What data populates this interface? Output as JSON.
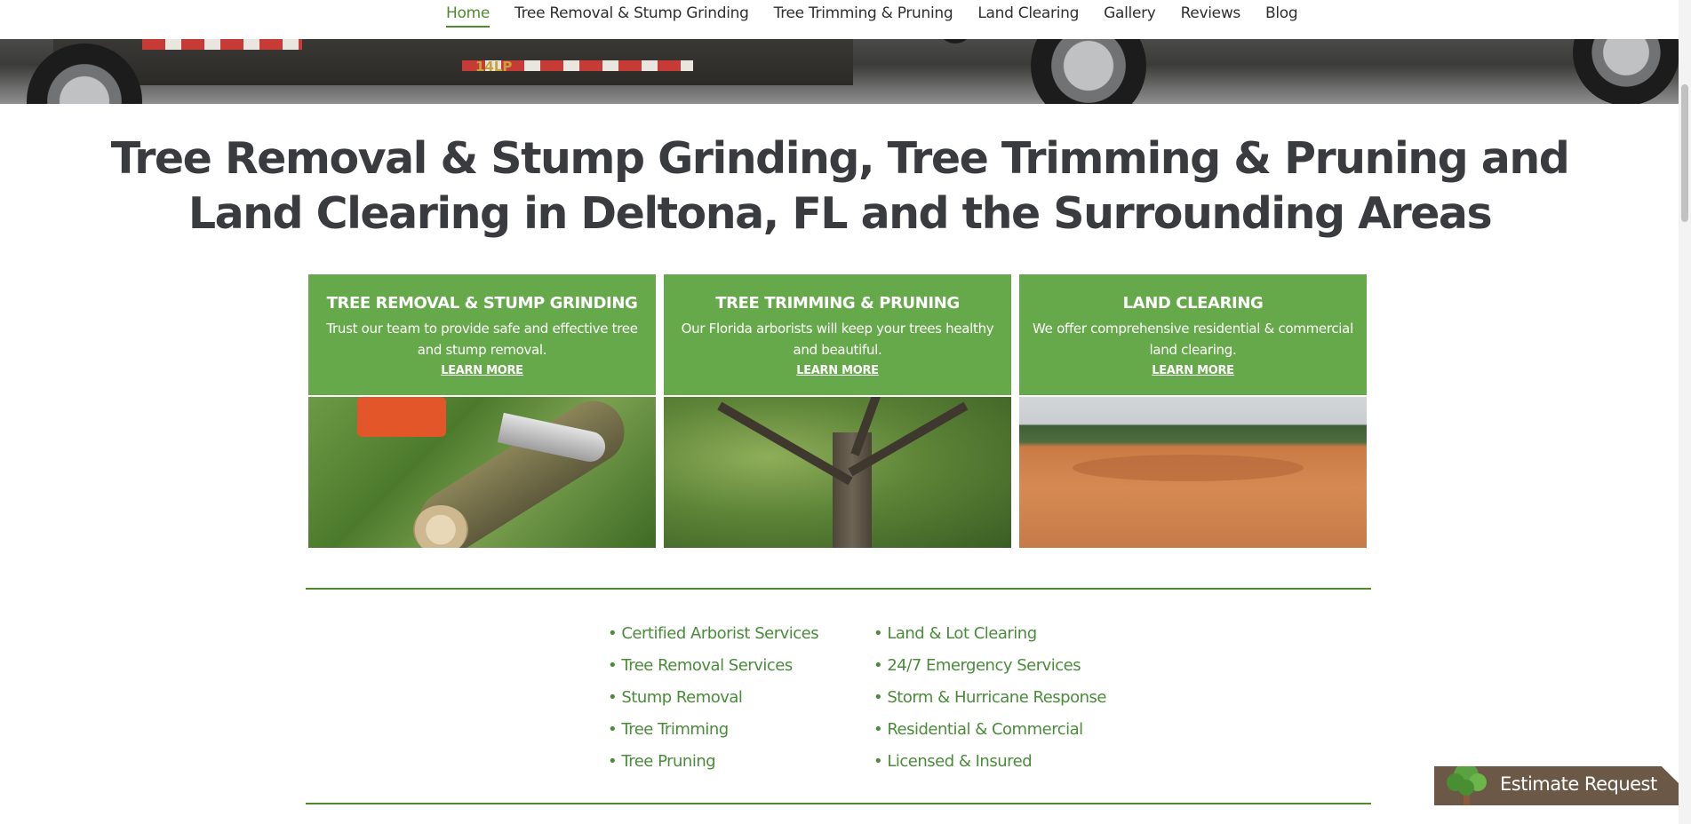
{
  "nav": {
    "items": [
      {
        "label": "Home",
        "active": true
      },
      {
        "label": "Tree Removal & Stump Grinding",
        "active": false
      },
      {
        "label": "Tree Trimming & Pruning",
        "active": false
      },
      {
        "label": "Land Clearing",
        "active": false
      },
      {
        "label": "Gallery",
        "active": false
      },
      {
        "label": "Reviews",
        "active": false
      },
      {
        "label": "Blog",
        "active": false
      }
    ]
  },
  "hero": {
    "trailer_tag": "14LP"
  },
  "headline": "Tree Removal & Stump Grinding, Tree Trimming & Pruning and Land Clearing in Deltona, FL and the Surrounding Areas",
  "cards": [
    {
      "title": "TREE REMOVAL & STUMP GRINDING",
      "description": "Trust our team to provide safe and effective tree and stump removal.",
      "link": "LEARN MORE"
    },
    {
      "title": "TREE TRIMMING & PRUNING",
      "description": "Our Florida arborists will keep your trees healthy and beautiful.",
      "link": "LEARN MORE"
    },
    {
      "title": "LAND CLEARING",
      "description": "We offer comprehensive residential & commercial land clearing.",
      "link": "LEARN MORE"
    }
  ],
  "services_left": [
    "Certified Arborist Services",
    "Tree Removal Services",
    "Stump Removal",
    "Tree Trimming",
    "Tree Pruning"
  ],
  "services_right": [
    "Land & Lot Clearing",
    "24/7 Emergency Services",
    "Storm & Hurricane Response",
    "Residential & Commercial",
    "Licensed & Insured"
  ],
  "estimate": {
    "label": "Estimate Request"
  },
  "colors": {
    "brand_green": "#66a94a",
    "accent_green": "#4f8a2f",
    "estimate_brown": "#6b5846",
    "text_dark": "#3a3b3e"
  }
}
